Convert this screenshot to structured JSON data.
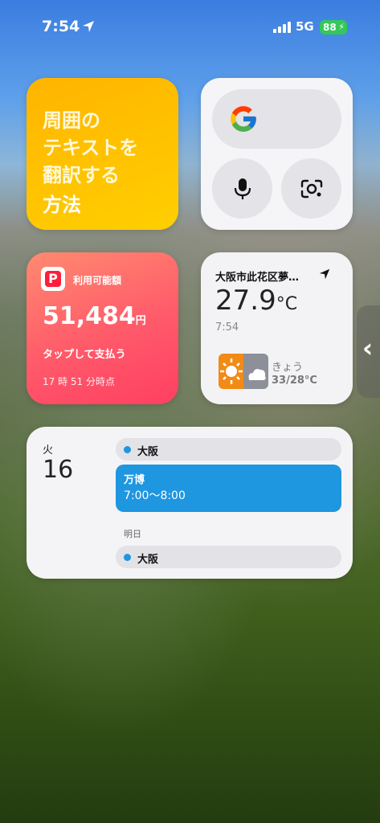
{
  "status": {
    "time": "7:54",
    "network": "5G",
    "battery": "88",
    "icons": [
      "location-arrow-icon",
      "signal-icon",
      "charging-bolt-icon"
    ]
  },
  "translate_widget": {
    "line1": "周囲の\nテキストを\n翻訳する",
    "line2": "方法"
  },
  "google_widget": {
    "icons": [
      "google-logo-icon",
      "microphone-icon",
      "camera-lens-icon"
    ]
  },
  "paypay_widget": {
    "label": "利用可能額",
    "amount": "51,484",
    "currency": "円",
    "action": "タップして支払う",
    "updated": "17 時 51 分時点"
  },
  "weather_widget": {
    "location": "大阪市此花区夢…",
    "temp": "27.9",
    "unit": "°C",
    "time": "7:54",
    "day": "きょう",
    "range": "33/28°C"
  },
  "calendar_widget": {
    "weekday": "火",
    "day": "16",
    "events": [
      {
        "title": "大阪",
        "type": "all-day"
      },
      {
        "title": "万博",
        "time": "7:00～8:00"
      }
    ],
    "tomorrow_label": "明日",
    "tomorrow_events": [
      {
        "title": "大阪",
        "type": "all-day"
      }
    ]
  },
  "side_handle": {
    "glyph": "‹"
  },
  "colors": {
    "translate": "#ffc200",
    "paypay": "#ff4f66",
    "event": "#1f96e0",
    "battery": "#34c759"
  }
}
